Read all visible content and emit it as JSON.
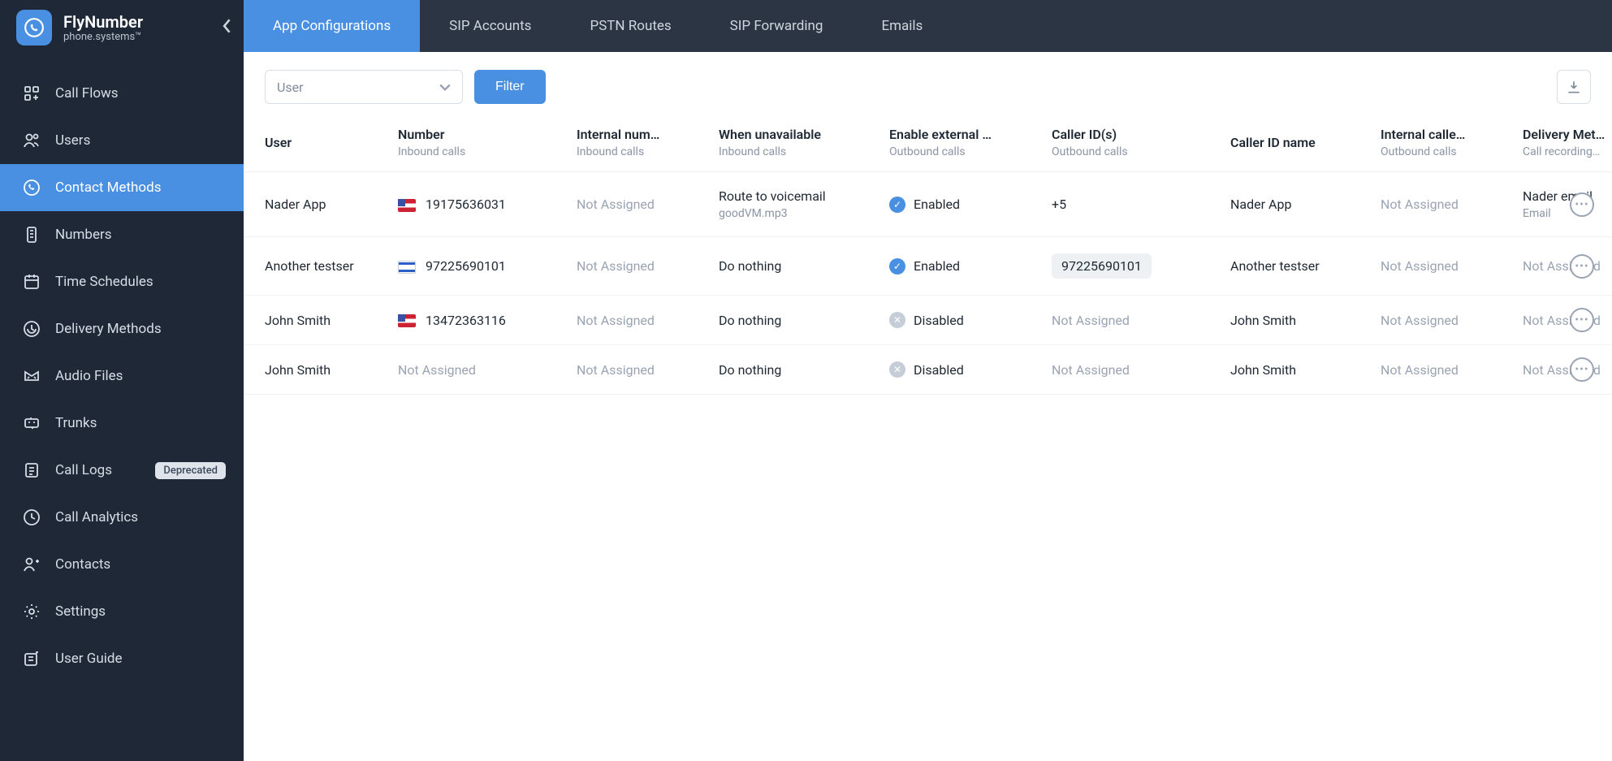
{
  "brand": {
    "title": "FlyNumber",
    "subtitle": "phone.systems™"
  },
  "sidebar": {
    "items": [
      {
        "label": "Call Flows"
      },
      {
        "label": "Users"
      },
      {
        "label": "Contact Methods",
        "active": true
      },
      {
        "label": "Numbers"
      },
      {
        "label": "Time Schedules"
      },
      {
        "label": "Delivery Methods"
      },
      {
        "label": "Audio Files"
      },
      {
        "label": "Trunks"
      },
      {
        "label": "Call Logs",
        "badge": "Deprecated"
      },
      {
        "label": "Call Analytics"
      },
      {
        "label": "Contacts"
      },
      {
        "label": "Settings"
      },
      {
        "label": "User Guide"
      }
    ]
  },
  "tabs": [
    {
      "label": "App Configurations",
      "active": true
    },
    {
      "label": "SIP Accounts"
    },
    {
      "label": "PSTN Routes"
    },
    {
      "label": "SIP Forwarding"
    },
    {
      "label": "Emails"
    }
  ],
  "toolbar": {
    "select_label": "User",
    "filter_label": "Filter"
  },
  "columns": [
    {
      "title": "User",
      "sub": ""
    },
    {
      "title": "Number",
      "sub": "Inbound calls"
    },
    {
      "title": "Internal num…",
      "sub": "Inbound calls"
    },
    {
      "title": "When unavailable",
      "sub": "Inbound calls"
    },
    {
      "title": "Enable external …",
      "sub": "Outbound calls"
    },
    {
      "title": "Caller ID(s)",
      "sub": "Outbound calls"
    },
    {
      "title": "Caller ID name",
      "sub": ""
    },
    {
      "title": "Internal calle…",
      "sub": "Outbound calls"
    },
    {
      "title": "Delivery Met…",
      "sub": "Call recording…"
    }
  ],
  "rows": [
    {
      "user": "Nader App",
      "number": "19175636031",
      "flag": "us",
      "internal_number": "Not Assigned",
      "unavailable": "Route to voicemail",
      "unavailable_sub": "goodVM.mp3",
      "external_enabled": true,
      "external_label": "Enabled",
      "caller_ids": "+5",
      "caller_id_name": "Nader App",
      "internal_caller": "Not Assigned",
      "delivery": "Nader email",
      "delivery_sub": "Email"
    },
    {
      "user": "Another testser",
      "number": "97225690101",
      "flag": "il",
      "internal_number": "Not Assigned",
      "unavailable": "Do nothing",
      "external_enabled": true,
      "external_label": "Enabled",
      "caller_ids": "97225690101",
      "caller_ids_chip": true,
      "caller_id_name": "Another testser",
      "internal_caller": "Not Assigned",
      "delivery": "Not Assigned"
    },
    {
      "user": "John Smith",
      "number": "13472363116",
      "flag": "us",
      "internal_number": "Not Assigned",
      "unavailable": "Do nothing",
      "external_enabled": false,
      "external_label": "Disabled",
      "caller_ids": "Not Assigned",
      "caller_id_name": "John Smith",
      "internal_caller": "Not Assigned",
      "delivery": "Not Assigned"
    },
    {
      "user": "John Smith",
      "number": "Not Assigned",
      "internal_number": "Not Assigned",
      "unavailable": "Do nothing",
      "external_enabled": false,
      "external_label": "Disabled",
      "caller_ids": "Not Assigned",
      "caller_id_name": "John Smith",
      "internal_caller": "Not Assigned",
      "delivery": "Not Assigned"
    }
  ]
}
